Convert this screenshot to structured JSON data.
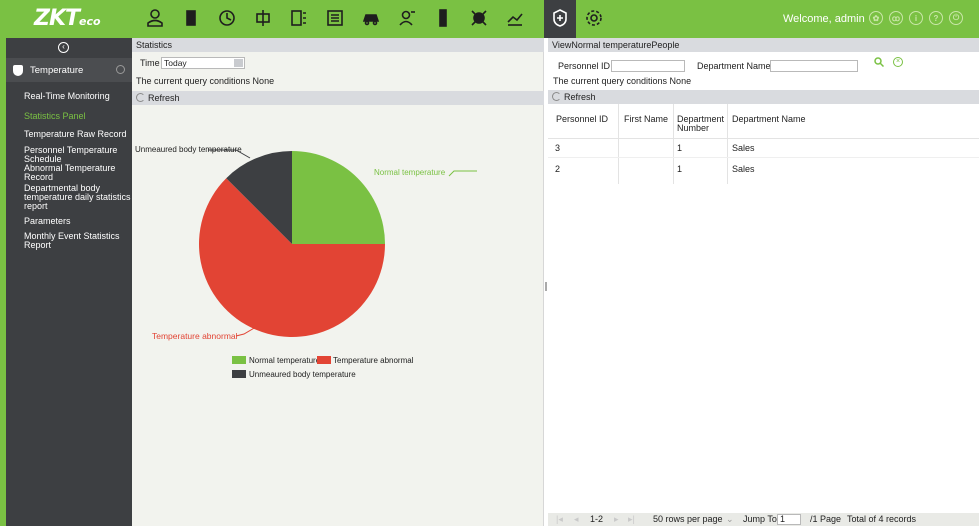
{
  "header": {
    "logo": "ZKTeco",
    "logo_main": "ZKT",
    "logo_suffix": "eco",
    "welcome": "Welcome, admin",
    "nav_icons": [
      "personnel-icon",
      "access-icon",
      "attendance-icon",
      "elevator-icon",
      "video-icon",
      "hotel-icon",
      "parking-icon",
      "visitor-icon",
      "patrol-icon",
      "intrusion-icon",
      "accessories-icon",
      "temperature-module-icon",
      "system-settings-icon"
    ],
    "right_icons": [
      "theme-icon",
      "user-icon",
      "info-icon",
      "help-icon",
      "logout-icon"
    ],
    "colors": {
      "brand": "#7ac143",
      "dark": "#3d3f42"
    }
  },
  "sidebar": {
    "module": "Temperature",
    "items": [
      "Real-Time Monitoring",
      "Statistics Panel",
      "Temperature Raw Record",
      "Personnel Temperature Schedule",
      "Abnormal Temperature Record",
      "Departmental body temperature daily statistics report",
      "Parameters",
      "Monthly Event Statistics Report"
    ],
    "active_index": 1
  },
  "left": {
    "title": "Statistics",
    "time_label": "Time",
    "time_value": "Today",
    "query_text": "The current query conditions None",
    "refresh": "Refresh"
  },
  "right": {
    "title": "ViewNormal temperaturePeople",
    "personnel_id_label": "Personnel ID",
    "department_name_label": "Department Name",
    "query_text": "The current query conditions None",
    "refresh": "Refresh",
    "columns": [
      "Personnel ID",
      "First Name",
      "Department Number",
      "Department Name"
    ],
    "rows": [
      [
        "3",
        "",
        "1",
        "Sales"
      ],
      [
        "2",
        "",
        "1",
        "Sales"
      ]
    ]
  },
  "pager": {
    "range": "1-2",
    "rows_per_page": "50 rows per page",
    "jump_to": "Jump To",
    "page_value": "1",
    "page_total": "/1 Page",
    "total": "Total of 4 records"
  },
  "chart_data": {
    "type": "pie",
    "slices": [
      {
        "name": "Normal temperature",
        "value": 2,
        "color": "#7ac143"
      },
      {
        "name": "Temperature abnormal",
        "value": 5,
        "color": "#e24434"
      },
      {
        "name": "Unmeaured body temperature",
        "value": 1,
        "color": "#3d3f42"
      }
    ],
    "legend": [
      "Normal temperature",
      "Temperature abnormal",
      "Unmeaured body temperature"
    ],
    "legend_position": "bottom"
  }
}
